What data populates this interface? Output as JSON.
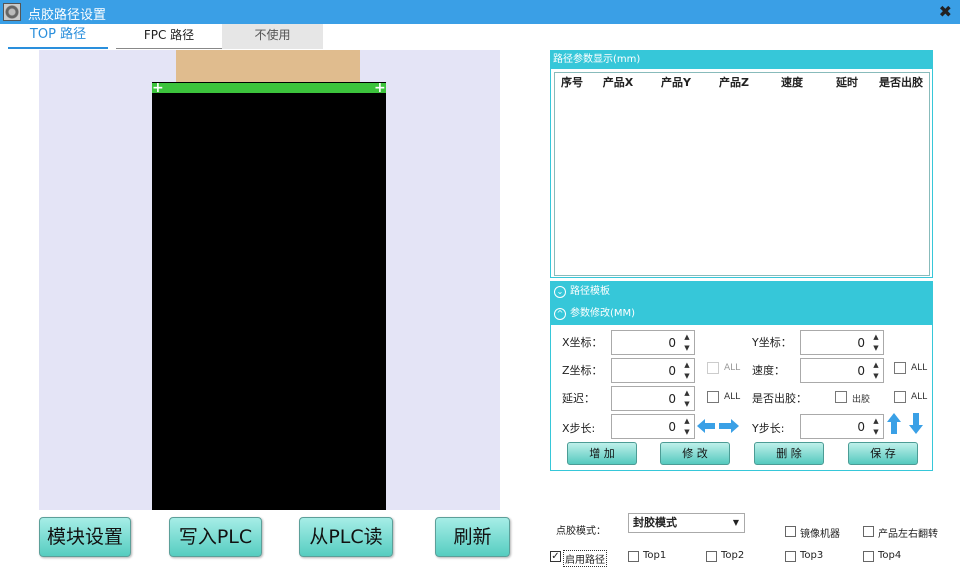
{
  "window": {
    "title": "点胶路径设置",
    "close_glyph": "✖"
  },
  "tabs": [
    {
      "label": "TOP 路径",
      "active": true
    },
    {
      "label": "FPC 路径",
      "active": false
    },
    {
      "label": "不使用",
      "active": false
    }
  ],
  "canvas": {
    "colors": {
      "background": "#e4e4f6",
      "fpc": "#e0bc8e",
      "product": "#000000",
      "path": "#3cc33c"
    }
  },
  "buttons": {
    "module_settings": "模块设置",
    "write_plc": "写入PLC",
    "read_plc": "从PLC读",
    "refresh": "刷新"
  },
  "path_panel": {
    "header": "路径参数显示(mm)",
    "columns": [
      "序号",
      "产品X",
      "产品Y",
      "产品Z",
      "速度",
      "延时",
      "是否出胶"
    ]
  },
  "accordion": {
    "template": "路径模板",
    "param_edit": "参数修改(MM)"
  },
  "params": {
    "x_label": "X坐标：",
    "x_value": "0",
    "y_label": "Y坐标：",
    "y_value": "0",
    "z_label": "Z坐标：",
    "z_value": "0",
    "speed_label": "速度：",
    "speed_value": "0",
    "delay_label": "延迟：",
    "delay_value": "0",
    "glue_label": "是否出胶：",
    "glue_check_label": "出胶",
    "xstep_label": "X步长:",
    "xstep_value": "0",
    "ystep_label": "Y步长:",
    "ystep_value": "0",
    "all_label": "ALL"
  },
  "actions": {
    "add": "增 加",
    "modify": "修 改",
    "delete": "删 除",
    "save": "保 存"
  },
  "bottom": {
    "mode_label": "点胶模式：",
    "mode_value": "封胶模式",
    "mirror": "镜像机器",
    "flip": "产品左右翻转",
    "enable_path": "启用路径",
    "top1": "Top1",
    "top2": "Top2",
    "top3": "Top3",
    "top4": "Top4"
  },
  "colors": {
    "accent": "#36c7d9",
    "titlebar": "#3a9fe6",
    "arrow_blue": "#3aa0e6"
  }
}
